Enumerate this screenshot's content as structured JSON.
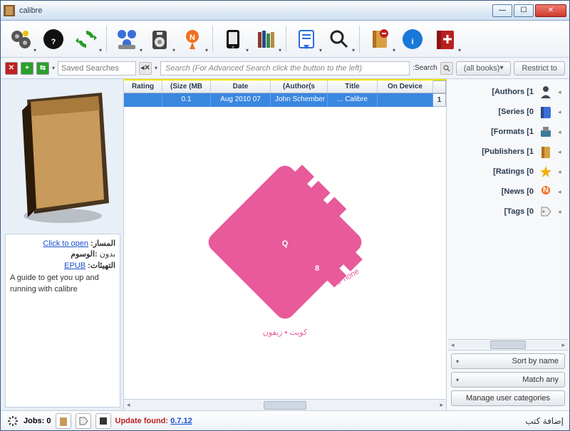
{
  "window": {
    "title": "calibre"
  },
  "searchbar": {
    "saved_label": "Saved Searches",
    "placeholder": "Search (For Advanced Search click the button to the left)",
    "search_label": ":Search",
    "allbooks": "(all books)",
    "restrict": "Restrict to"
  },
  "table": {
    "headers": {
      "rating": "Rating",
      "size": "(Size (MB",
      "date": "Date",
      "authors": "(Author(s",
      "title": "Title",
      "ondevice": "On Device"
    },
    "row": {
      "rating": "",
      "size": "0.1",
      "date": "Aug 2010 07",
      "authors": "John Schember",
      "title": "... Calibre",
      "ondevice": "",
      "num": "1"
    }
  },
  "info": {
    "path_k": ":المسار",
    "path_v": "Click to open",
    "tags_k": ":الوسوم",
    "tags_v": "بدون",
    "formats_k": ":التهيئات",
    "formats_v": "EPUB",
    "desc": "A guide to get you up and running with calibre"
  },
  "categories": [
    {
      "label": "[Authors [1"
    },
    {
      "label": "[Series [0"
    },
    {
      "label": "[Formats [1"
    },
    {
      "label": "[Publishers [1"
    },
    {
      "label": "[Ratings [0"
    },
    {
      "label": "[News [0"
    },
    {
      "label": "[Tags [0"
    }
  ],
  "right_buttons": {
    "sort": "Sort by name",
    "match": "Match any",
    "manage": "Manage user categories"
  },
  "status": {
    "jobs": "Jobs: 0",
    "update_prefix": "Update found: ",
    "update_ver": "0.7.12",
    "rt": "إضافة كتب"
  }
}
